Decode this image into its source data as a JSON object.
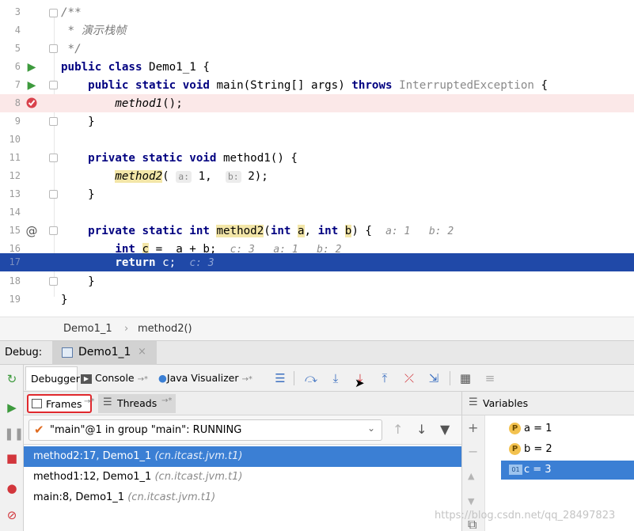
{
  "editor": {
    "lines": {
      "l3": {
        "num": "3",
        "text": "/**"
      },
      "l4": {
        "num": "4",
        "text": " * 演示栈帧"
      },
      "l5": {
        "num": "5",
        "text": " */"
      },
      "l6": {
        "num": "6",
        "kw": "public class",
        "rest": " Demo1_1 {"
      },
      "l7": {
        "num": "7",
        "kw1": "public static void",
        "name": " main(String[] args) ",
        "kw2": "throws",
        "exc": " InterruptedException",
        "end": " {"
      },
      "l8": {
        "num": "8",
        "call": "method1",
        "end": "();"
      },
      "l9": {
        "num": "9",
        "text": "}"
      },
      "l10": {
        "num": "10"
      },
      "l11": {
        "num": "11",
        "kw": "private static void",
        "rest": " method1() {"
      },
      "l12": {
        "num": "12",
        "call": "method2",
        "open": "(",
        "hint_a": "a:",
        "arg_a": " 1,",
        "hint_b": "b:",
        "arg_b": " 2);"
      },
      "l13": {
        "num": "13",
        "text": "}"
      },
      "l14": {
        "num": "14"
      },
      "l15": {
        "num": "15",
        "kw1": "private static int",
        "name": "method2",
        "p1_kw": "int",
        "p1_name": "a",
        "p2_kw": "int",
        "p2_name": "b",
        "end": ") {",
        "inline": "a: 1   b: 2"
      },
      "l16": {
        "num": "16",
        "kw": "int",
        "var": "c",
        "rest": " =  a + b;",
        "inline": "c: 3   a: 1   b: 2"
      },
      "l17": {
        "num": "17",
        "kw": "return",
        "rest": " c;",
        "inline": "c: 3"
      },
      "l18": {
        "num": "18",
        "text": "}"
      },
      "l19": {
        "num": "19",
        "text": "}"
      }
    },
    "at_marker": "@"
  },
  "breadcrumb": {
    "class": "Demo1_1",
    "sep": "›",
    "method": "method2()"
  },
  "debug": {
    "label": "Debug:",
    "tab_title": "Demo1_1",
    "tab_close": "×"
  },
  "toolbar": {
    "debugger": "Debugger",
    "console": "Console",
    "java_visualizer": "Java Visualizer",
    "pin": "→*"
  },
  "frames": {
    "frames_tab": "Frames",
    "threads_tab": "Threads",
    "pin": "→*",
    "thread": "\"main\"@1 in group \"main\": RUNNING",
    "list": [
      {
        "method": "method2:17, Demo1_1",
        "pkg": "(cn.itcast.jvm.t1)"
      },
      {
        "method": "method1:12, Demo1_1",
        "pkg": "(cn.itcast.jvm.t1)"
      },
      {
        "method": "main:8, Demo1_1",
        "pkg": "(cn.itcast.jvm.t1)"
      }
    ]
  },
  "variables": {
    "title": "Variables",
    "list": [
      {
        "badge": "P",
        "text": "a = 1"
      },
      {
        "badge": "P",
        "text": "b = 2"
      },
      {
        "badge": "01",
        "text": "c = 3"
      }
    ]
  },
  "watermark": "https://blog.csdn.net/qq_28497823",
  "colors": {
    "current_line": "#2049a8",
    "breakpoint_line": "#fbe8e8",
    "selection": "#3b7fd4",
    "highlight_box": "#e0282d"
  }
}
